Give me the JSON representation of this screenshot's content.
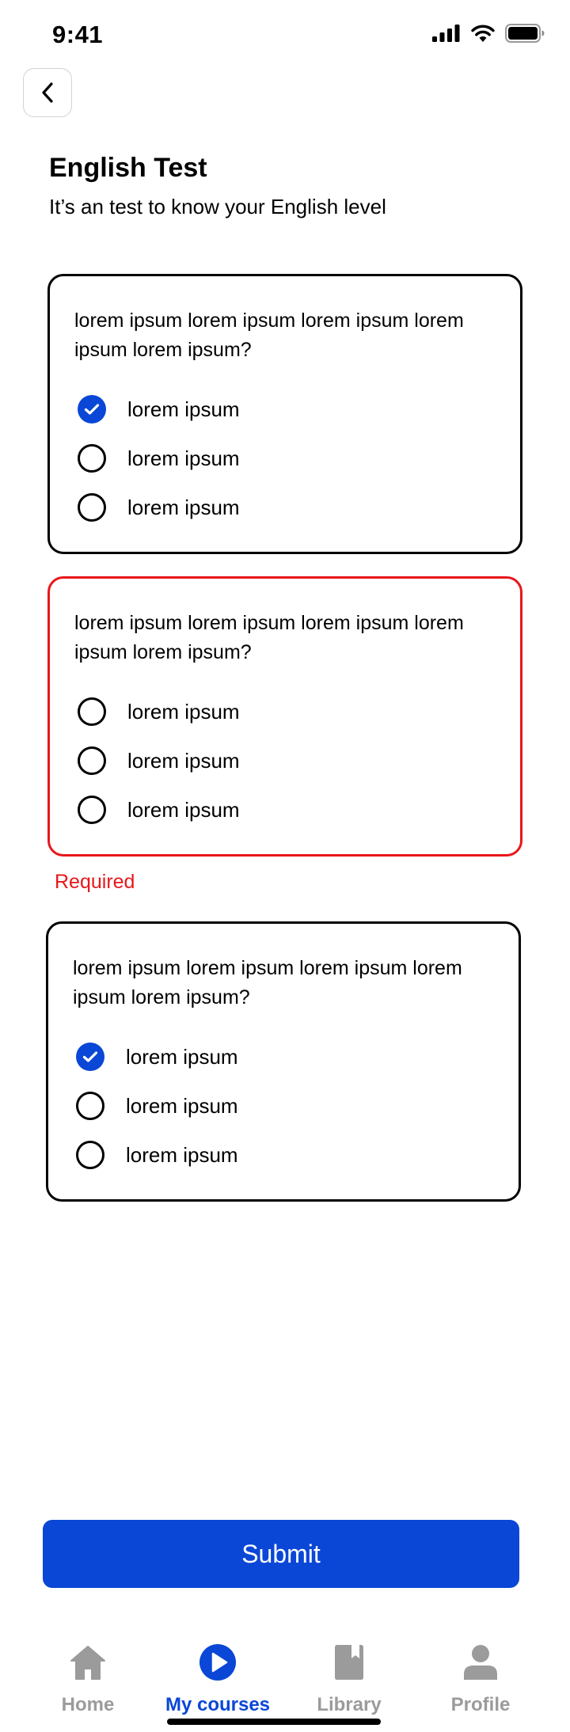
{
  "status_bar": {
    "time": "9:41"
  },
  "header": {
    "title": "English Test",
    "subtitle": "It’s an test to know your English level"
  },
  "questions": [
    {
      "text": "lorem ipsum lorem ipsum lorem ipsum lorem ipsum lorem ipsum?",
      "state": "answered",
      "options": [
        {
          "label": "lorem ipsum",
          "checked": true
        },
        {
          "label": "lorem ipsum",
          "checked": false
        },
        {
          "label": "lorem ipsum",
          "checked": false
        }
      ]
    },
    {
      "text": "lorem ipsum lorem ipsum lorem ipsum lorem ipsum lorem ipsum?",
      "state": "error",
      "error_message": "Required",
      "options": [
        {
          "label": "lorem ipsum",
          "checked": false
        },
        {
          "label": "lorem ipsum",
          "checked": false
        },
        {
          "label": "lorem ipsum",
          "checked": false
        }
      ]
    },
    {
      "text": "lorem ipsum lorem ipsum lorem ipsum lorem ipsum lorem ipsum?",
      "state": "answered",
      "options": [
        {
          "label": "lorem ipsum",
          "checked": true
        },
        {
          "label": "lorem ipsum",
          "checked": false
        },
        {
          "label": "lorem ipsum",
          "checked": false
        }
      ]
    }
  ],
  "submit_label": "Submit",
  "tab_bar": {
    "items": [
      {
        "label": "Home",
        "icon": "home-icon",
        "active": false
      },
      {
        "label": "My courses",
        "icon": "play-circle-icon",
        "active": true
      },
      {
        "label": "Library",
        "icon": "book-icon",
        "active": false
      },
      {
        "label": "Profile",
        "icon": "person-icon",
        "active": false
      }
    ]
  },
  "colors": {
    "accent": "#0a47d6",
    "error": "#e8171b",
    "inactive_tab": "#9b9b9b"
  }
}
